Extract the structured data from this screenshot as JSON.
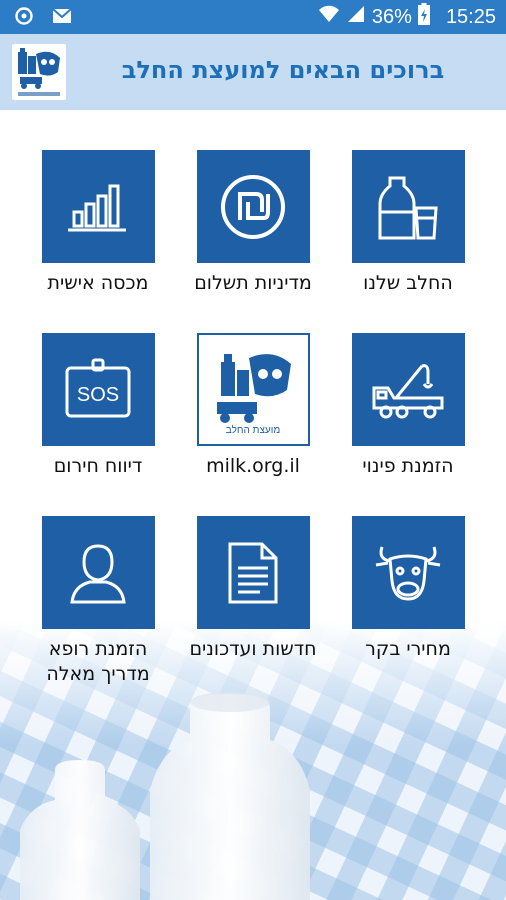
{
  "status_bar": {
    "battery": "36%",
    "time": "15:25",
    "icons": [
      "sync-icon",
      "mail-icon",
      "wifi-icon",
      "signal-icon",
      "battery-icon"
    ]
  },
  "header": {
    "title": "ברוכים הבאים למועצת החלב",
    "logo_icon": "milk-council-logo-icon"
  },
  "tiles": [
    {
      "id": "our-milk",
      "label": "החלב שלנו",
      "icon": "milk-bottle-icon"
    },
    {
      "id": "payment-policy",
      "label": "מדיניות תשלום",
      "icon": "shekel-icon"
    },
    {
      "id": "personal-quota",
      "label": "מכסה אישית",
      "icon": "bar-chart-icon"
    },
    {
      "id": "order-evacuation",
      "label": "הזמנת פינוי",
      "icon": "tow-truck-icon"
    },
    {
      "id": "milk-site",
      "label": "milk.org.il",
      "icon": "milk-council-logo-icon"
    },
    {
      "id": "emergency-report",
      "label": "דיווח חירום",
      "icon": "sos-icon"
    },
    {
      "id": "cattle-prices",
      "label": "מחירי בקר",
      "icon": "cow-icon"
    },
    {
      "id": "news-updates",
      "label": "חדשות ועדכונים",
      "icon": "document-icon"
    },
    {
      "id": "order-vet",
      "label_line1": "הזמנת רופא",
      "label_line2": "מדריך מאלה",
      "icon": "person-icon"
    }
  ],
  "logo_caption": "מועצת החלב",
  "colors": {
    "status_bar": "#2c7cc6",
    "header_bg": "#c5dcf3",
    "title": "#1d6fb8",
    "tile": "#1f5fa5"
  }
}
